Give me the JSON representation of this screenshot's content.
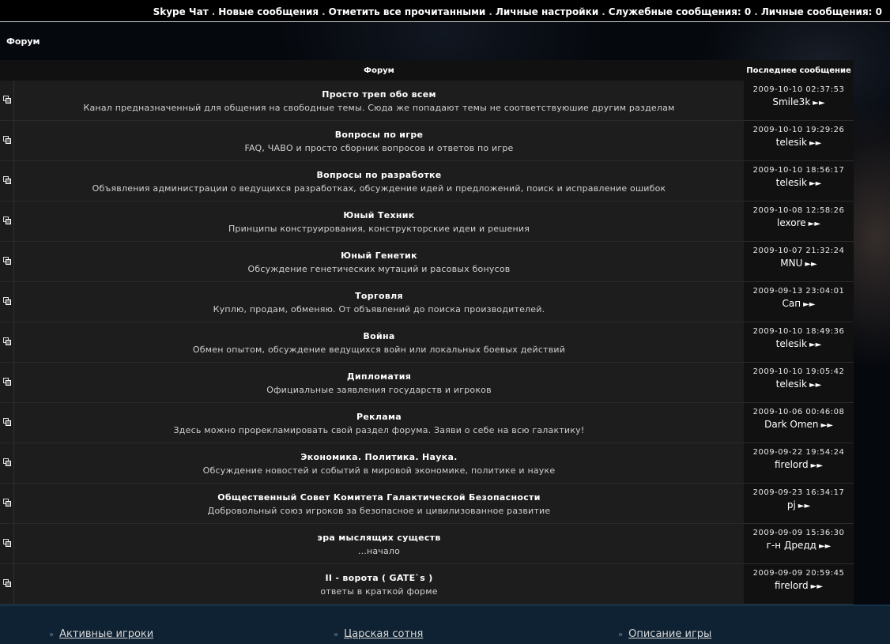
{
  "topbar": {
    "items": [
      "Skype Чат",
      "Новые сообщения",
      "Отметить все прочитанными",
      "Личные настройки",
      "Служебные сообщения: 0",
      "Личные сообщения: 0"
    ],
    "separator": "."
  },
  "page": {
    "title": "Форум"
  },
  "table": {
    "col_forum": "Форум",
    "col_last": "Последнее сообщение",
    "rows": [
      {
        "name": "Просто треп обо всем",
        "desc": "Канал предназначенный для общения на свободные темы. Сюда же попадают темы не соответствуюшие другим разделам",
        "date": "2009-10-10 02:37:53",
        "user": "Smile3k"
      },
      {
        "name": "Вопросы по игре",
        "desc": "FAQ, ЧАВО и просто сборник вопросов и ответов по игре",
        "date": "2009-10-10 19:29:26",
        "user": "telesik"
      },
      {
        "name": "Вопросы по разработке",
        "desc": "Объявления администрации о ведущихся разработках, обсуждение идей и предложений, поиск и исправление ошибок",
        "date": "2009-10-10 18:56:17",
        "user": "telesik"
      },
      {
        "name": "Юный Техник",
        "desc": "Принципы конструирования, конструкторские идеи и решения",
        "date": "2009-10-08 12:58:26",
        "user": "lexore"
      },
      {
        "name": "Юный Генетик",
        "desc": "Обсуждение генетических мутаций и расовых бонусов",
        "date": "2009-10-07 21:32:24",
        "user": "MNU"
      },
      {
        "name": "Торговля",
        "desc": "Куплю, продам, обменяю. От объявлений до поиска производителей.",
        "date": "2009-09-13 23:04:01",
        "user": "Сап"
      },
      {
        "name": "Война",
        "desc": "Обмен опытом, обсуждение ведущихся войн или локальных боевых действий",
        "date": "2009-10-10 18:49:36",
        "user": "telesik"
      },
      {
        "name": "Дипломатия",
        "desc": "Официальные заявления государств и игроков",
        "date": "2009-10-10 19:05:42",
        "user": "telesik"
      },
      {
        "name": "Реклама",
        "desc": "Здесь можно прорекламировать свой раздел форума. Заяви о себе на всю галактику!",
        "date": "2009-10-06 00:46:08",
        "user": "Dark Omen"
      },
      {
        "name": "Экономика. Политика. Наука.",
        "desc": "Обсуждение новостей и событий в мировой экономике, политике и науке",
        "date": "2009-09-22 19:54:24",
        "user": "firelord"
      },
      {
        "name": "Общественный Совет Комитета Галактической Безопасности",
        "desc": "Добровольный союз игроков за безопасное и цивилизованное развитие",
        "date": "2009-09-23 16:34:17",
        "user": "pj"
      },
      {
        "name": "эра мыслящих существ",
        "desc": "...начало",
        "date": "2009-09-09 15:36:30",
        "user": "г-н Дредд"
      },
      {
        "name": "II - ворота ( GATE`s )",
        "desc": "ответы в краткой форме",
        "date": "2009-09-09 20:59:45",
        "user": "firelord"
      }
    ]
  },
  "footer": {
    "links": [
      "Активные игроки",
      "Царская сотня",
      "Описание игры"
    ]
  },
  "icons": {
    "forum": "forum-folder-icon",
    "goto": "goto-last-post-icon",
    "link": "chevron-right-icon"
  }
}
